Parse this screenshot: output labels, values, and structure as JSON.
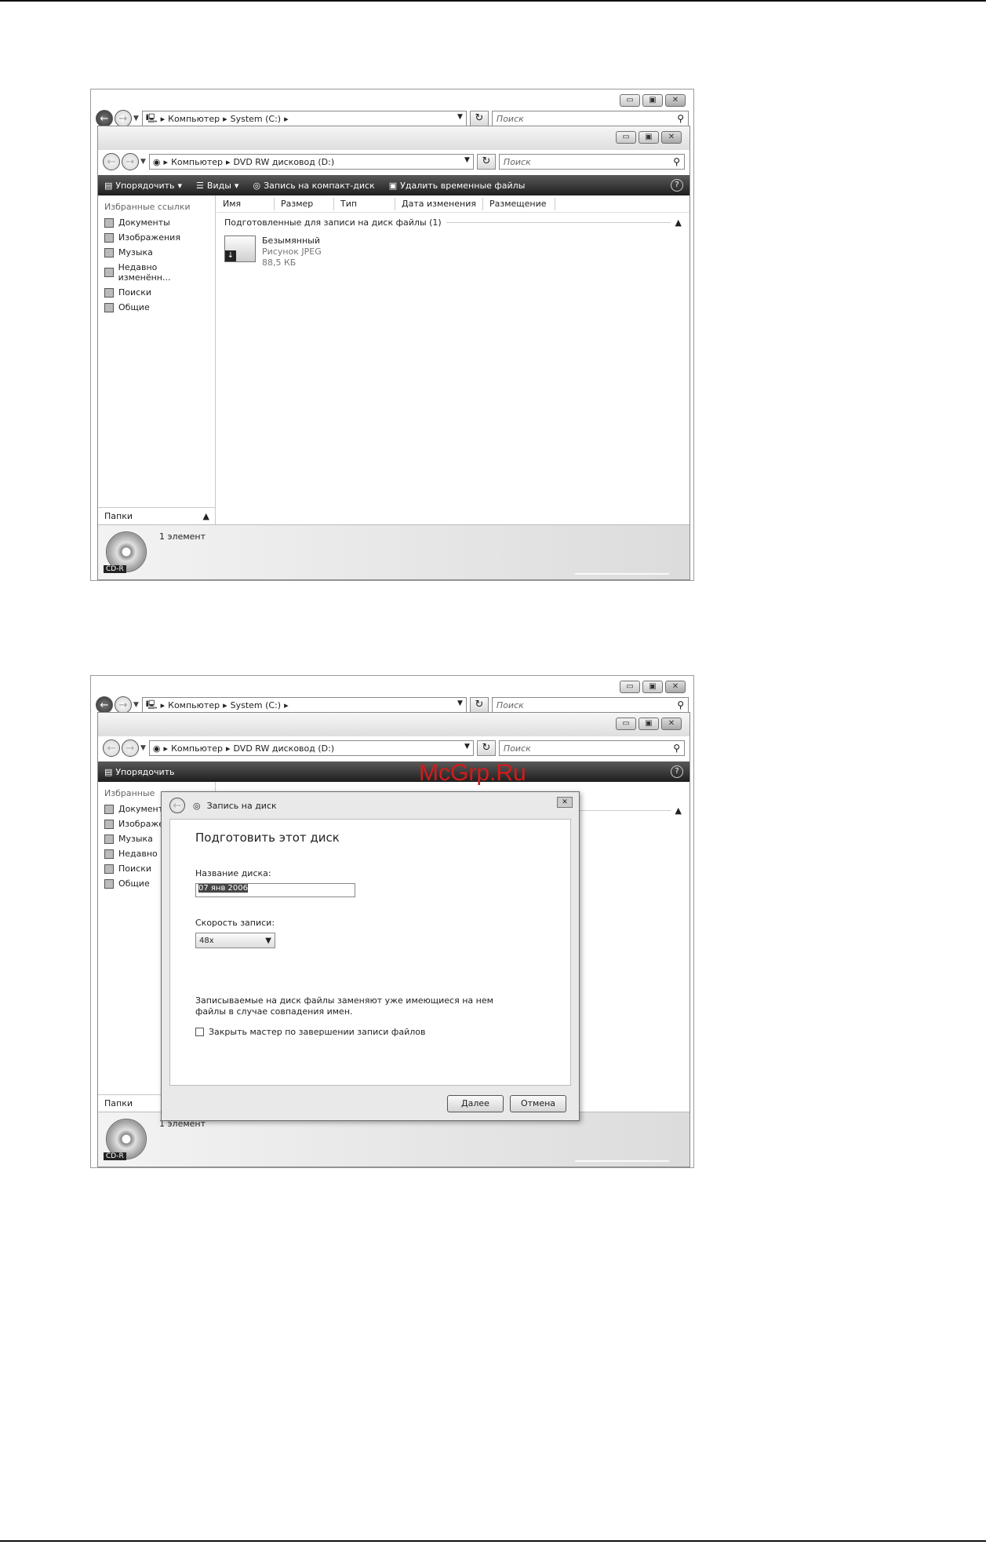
{
  "watermark": "McGrp.Ru",
  "outer": {
    "path": [
      "Компьютер",
      "System (C:)"
    ],
    "search_placeholder": "Поиск"
  },
  "explorer": {
    "path": [
      "Компьютер",
      "DVD RW дисковод (D:)"
    ],
    "search_placeholder": "Поиск",
    "toolbar": {
      "organize": "Упорядочить",
      "views": "Виды",
      "burn": "Запись на компакт-диск",
      "delete_temp": "Удалить временные файлы"
    },
    "sidebar": {
      "heading": "Избранные ссылки",
      "items": [
        "Документы",
        "Изображения",
        "Музыка",
        "Недавно изменённ...",
        "Поиски",
        "Общие"
      ],
      "folders": "Папки"
    },
    "columns": [
      "Имя",
      "Размер",
      "Тип",
      "Дата изменения",
      "Размещение"
    ],
    "group": "Подготовленные для записи на диск файлы (1)",
    "file": {
      "name": "Безымянный",
      "type": "Рисунок JPEG",
      "size": "88,5 КБ"
    },
    "status": {
      "count": "1 элемент",
      "disc_label": "CD-R"
    }
  },
  "explorer_b": {
    "path": [
      "Компьютер",
      "DVD RW дисковод (D:)"
    ],
    "search_placeholder": "Поиск",
    "toolbar_organize": "Упорядочить",
    "sidebar": {
      "heading": "Избранные",
      "items": [
        "Документы",
        "Изображения",
        "Музыка",
        "Недавно",
        "Поиски",
        "Общие"
      ],
      "folders": "Папки"
    },
    "status": {
      "count": "1 элемент",
      "disc_label": "CD-R"
    }
  },
  "dialog": {
    "title": "Запись на диск",
    "heading": "Подготовить этот диск",
    "disc_name_label": "Название диска:",
    "disc_name_value": "07 янв 2006",
    "speed_label": "Скорость записи:",
    "speed_value": "48x",
    "note": "Записываемые на диск файлы заменяют уже имеющиеся на нем файлы в случае совпадения имен.",
    "checkbox_label": "Закрыть мастер по завершении записи файлов",
    "next": "Далее",
    "cancel": "Отмена"
  }
}
